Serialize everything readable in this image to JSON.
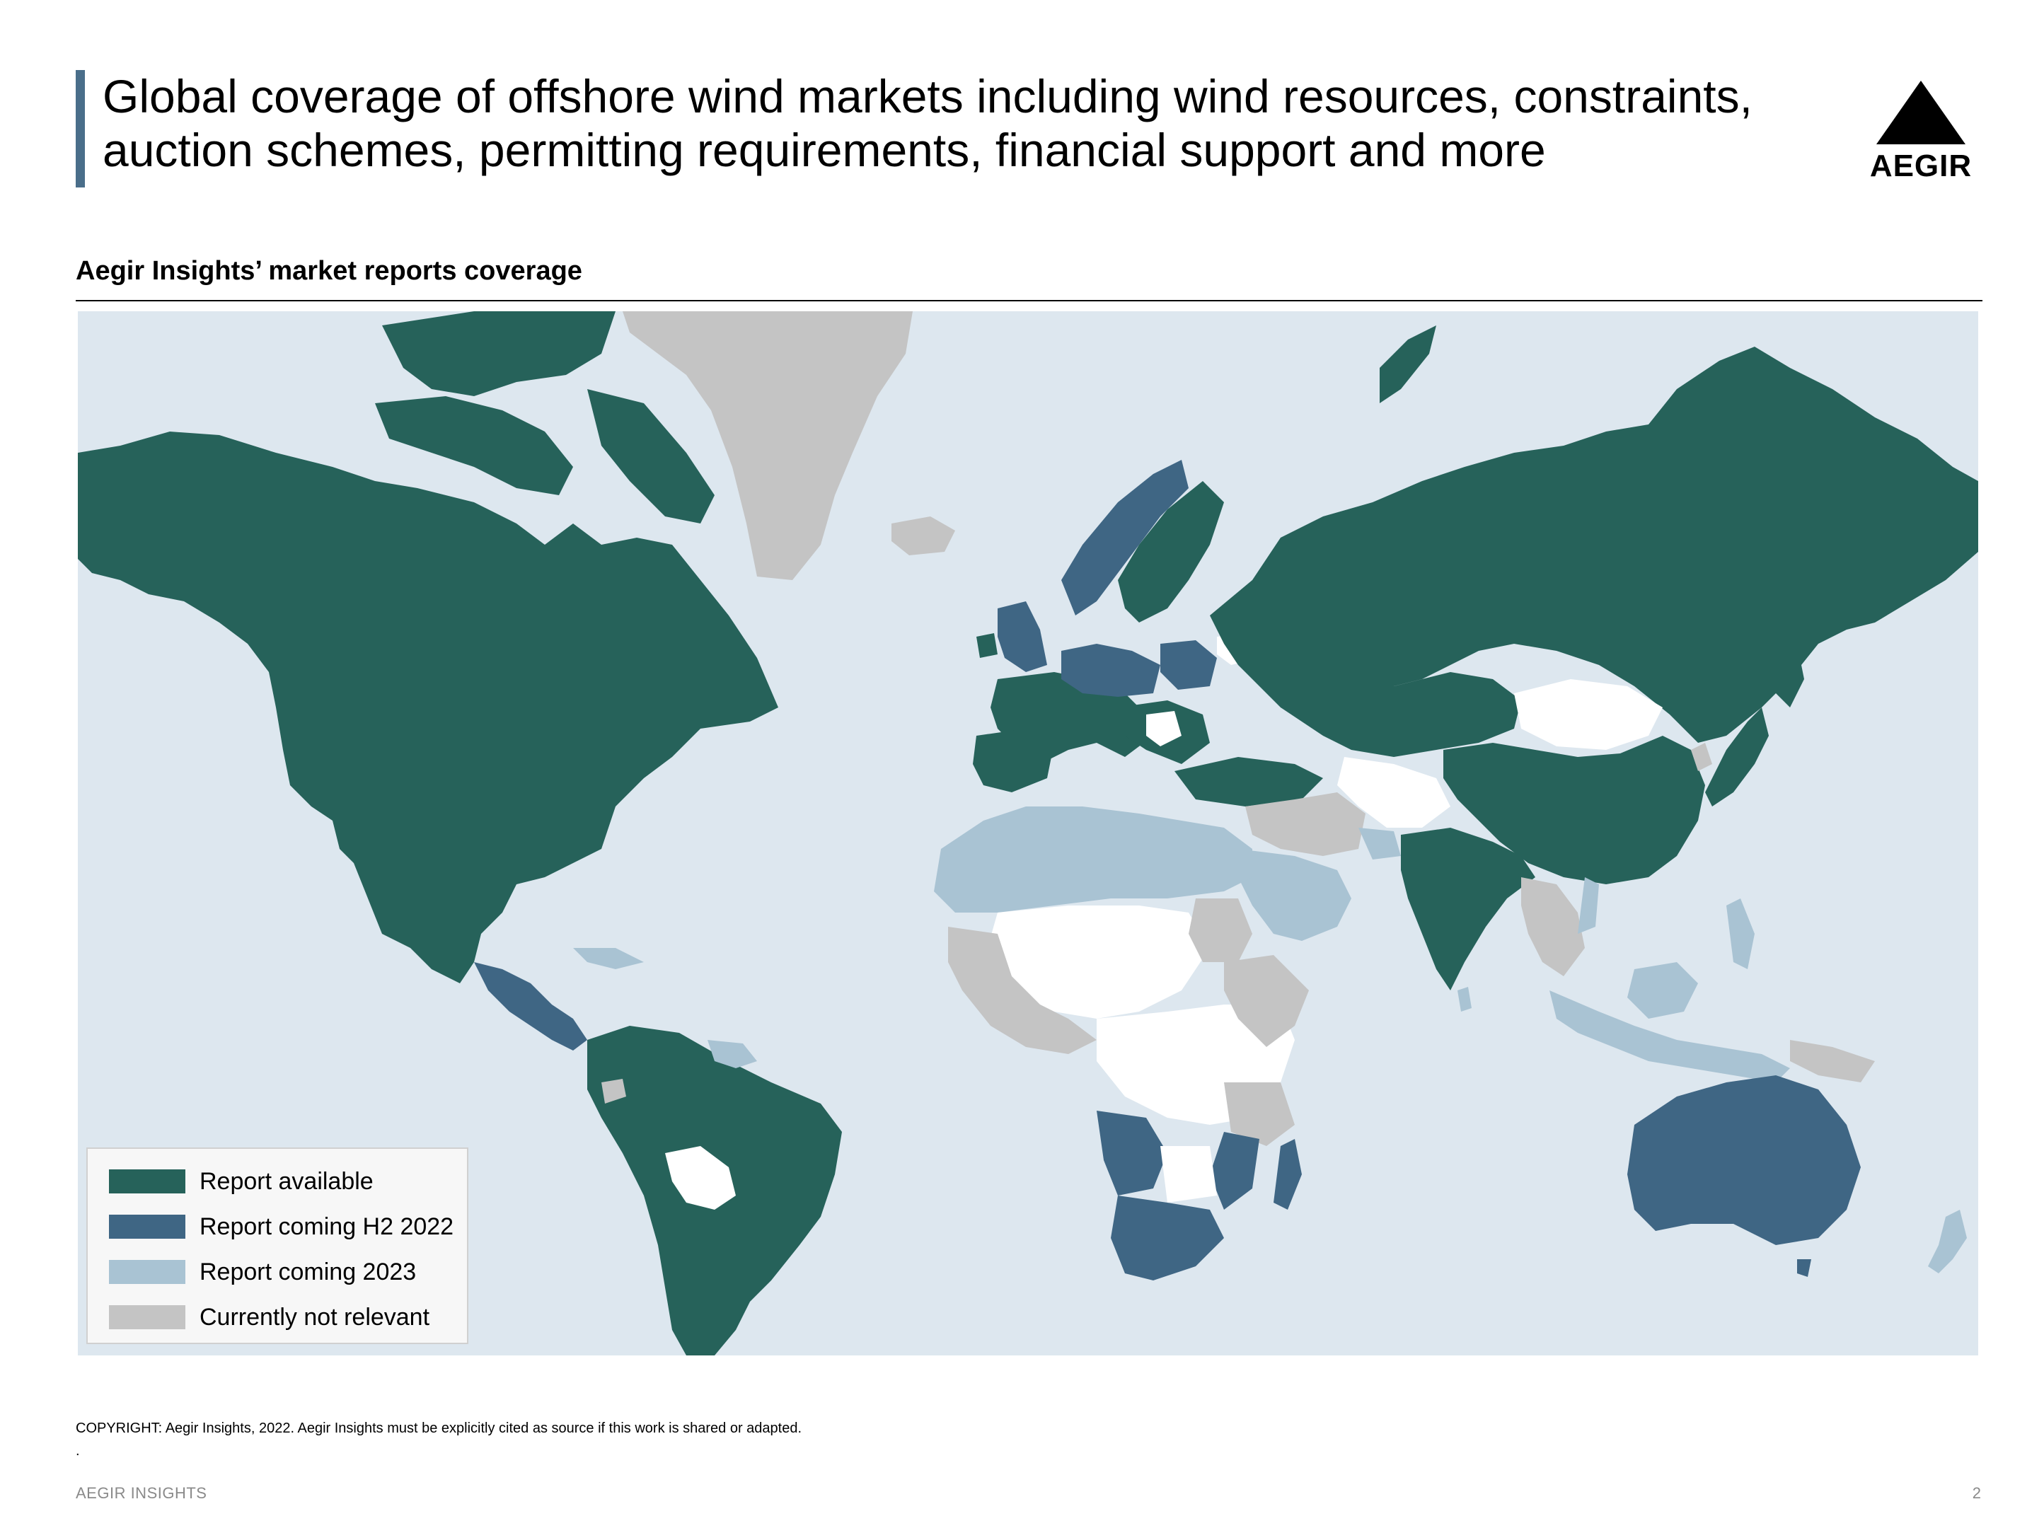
{
  "header": {
    "title_line1": "Global coverage of offshore wind markets including wind resources, constraints,",
    "title_line2": "auction schemes, permitting requirements, financial support and more",
    "logo_text": "AEGIR"
  },
  "subtitle": "Aegir Insights’ market reports coverage",
  "legend": [
    {
      "label": "Report available",
      "color": "#26625a"
    },
    {
      "label": "Report coming H2 2022",
      "color": "#3f6684"
    },
    {
      "label": "Report coming 2023",
      "color": "#a9c3d3"
    },
    {
      "label": "Currently not relevant",
      "color": "#c4c4c4"
    }
  ],
  "map": {
    "ocean_color": "#dde7ef",
    "no_data_color": "#ffffff",
    "regions": [
      {
        "name": "North America",
        "status": "Report available"
      },
      {
        "name": "Central America",
        "status": "Report coming H2 2022"
      },
      {
        "name": "South America",
        "status": "Report available"
      },
      {
        "name": "Greenland",
        "status": "Currently not relevant"
      },
      {
        "name": "Russia",
        "status": "Report available"
      },
      {
        "name": "China",
        "status": "Report available"
      },
      {
        "name": "India",
        "status": "Report available"
      },
      {
        "name": "Japan",
        "status": "Report available"
      },
      {
        "name": "Norway",
        "status": "Report coming H2 2022"
      },
      {
        "name": "United Kingdom",
        "status": "Report coming H2 2022"
      },
      {
        "name": "Poland",
        "status": "Report coming H2 2022"
      },
      {
        "name": "Southern Africa",
        "status": "Report coming H2 2022"
      },
      {
        "name": "Australia",
        "status": "Report coming H2 2022"
      },
      {
        "name": "North Africa",
        "status": "Report coming 2023"
      },
      {
        "name": "Arabian Peninsula",
        "status": "Report coming 2023"
      },
      {
        "name": "Southeast Asia",
        "status": "Report coming 2023"
      },
      {
        "name": "New Zealand",
        "status": "Report coming 2023"
      },
      {
        "name": "Middle East",
        "status": "Currently not relevant"
      }
    ]
  },
  "footer": {
    "copyright": "COPYRIGHT: Aegir Insights, 2022. Aegir Insights must be explicitly cited as source if this work is shared or adapted.",
    "dot": ".",
    "left": "AEGIR INSIGHTS",
    "page": "2"
  }
}
